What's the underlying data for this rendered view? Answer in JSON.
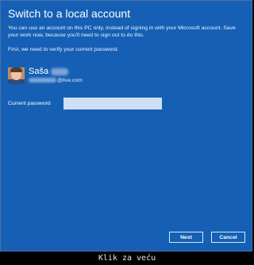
{
  "dialog": {
    "title": "Switch to a local account",
    "intro": "You can use an account on this PC only, instead of signing in with your Microsoft account. Save your work now, because you'll need to sign out to do this.",
    "verify_text": "First, we need to verify your current password."
  },
  "account": {
    "first_name": "Saša",
    "email_domain": "@live.com",
    "avatar_icon": "user-photo"
  },
  "password": {
    "label": "Current password",
    "value": "",
    "placeholder": ""
  },
  "buttons": {
    "next_label": "Next",
    "cancel_label": "Cancel"
  },
  "caption": "Klik za veću",
  "colors": {
    "background": "#1560b4",
    "input": "#cfe0f5",
    "text": "#ffffff"
  }
}
